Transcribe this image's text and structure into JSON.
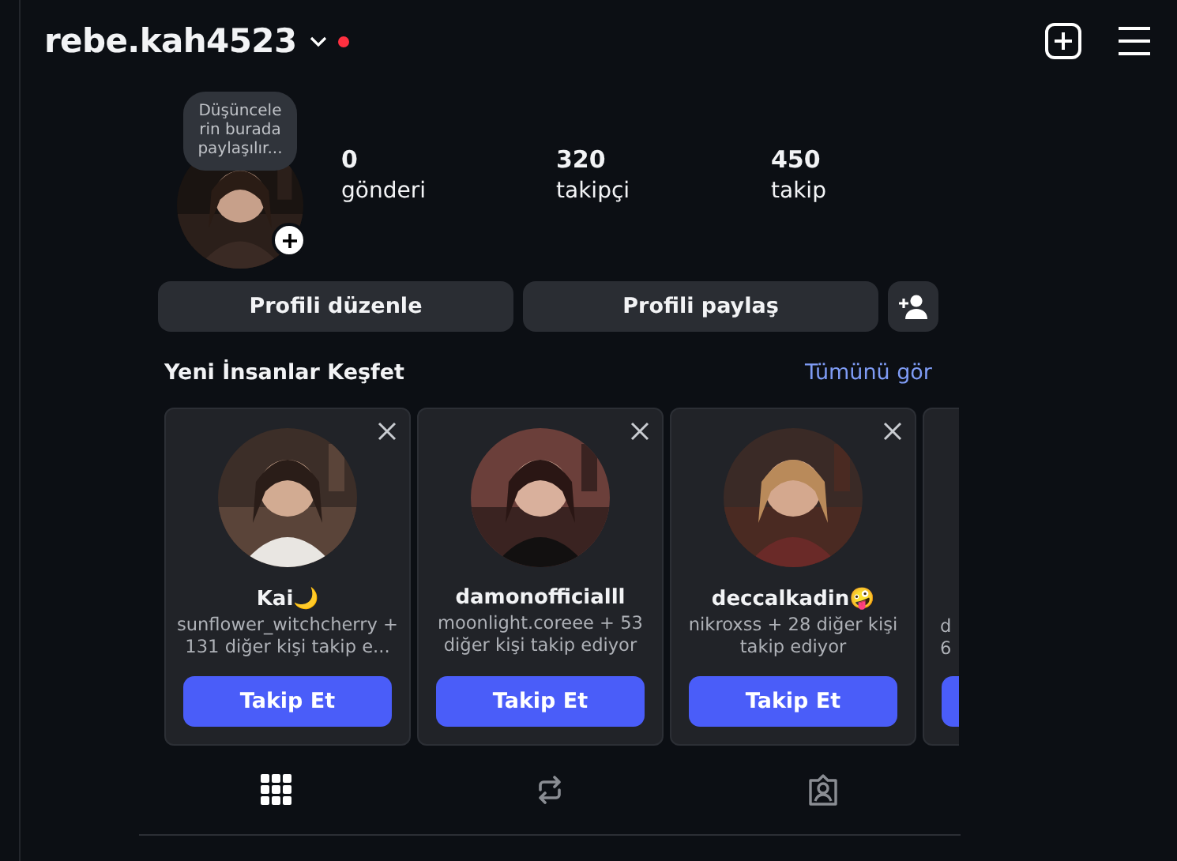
{
  "header": {
    "username": "rebe.kah4523",
    "has_notification": true
  },
  "profile": {
    "note": "Düşüncele rin burada paylaşılır...",
    "stats": [
      {
        "value": "0",
        "label": "gönderi"
      },
      {
        "value": "320",
        "label": "takipçi"
      },
      {
        "value": "450",
        "label": "takip"
      }
    ]
  },
  "actions": [
    "Profili düzenle",
    "Profili paylaş"
  ],
  "discover": {
    "title": "Yeni İnsanlar Keşfet",
    "see_all": "Tümünü gör",
    "cards": [
      {
        "name": "Kai🌙",
        "subtitle": "sunflower_witchcherry + 131 diğer kişi takip e...",
        "button": "Takip Et"
      },
      {
        "name": "damonofficialll",
        "subtitle": "moonlight.coreee + 53 diğer kişi takip ediyor",
        "button": "Takip Et"
      },
      {
        "name": "deccalkadin🤪",
        "subtitle": "nikroxss + 28 diğer kişi takip ediyor",
        "button": "Takip Et"
      }
    ],
    "peek_lines": [
      "d",
      "6"
    ]
  },
  "tabs": [
    {
      "kind": "grid",
      "selected": true
    },
    {
      "kind": "reposts",
      "selected": false
    },
    {
      "kind": "tagged",
      "selected": false
    }
  ]
}
